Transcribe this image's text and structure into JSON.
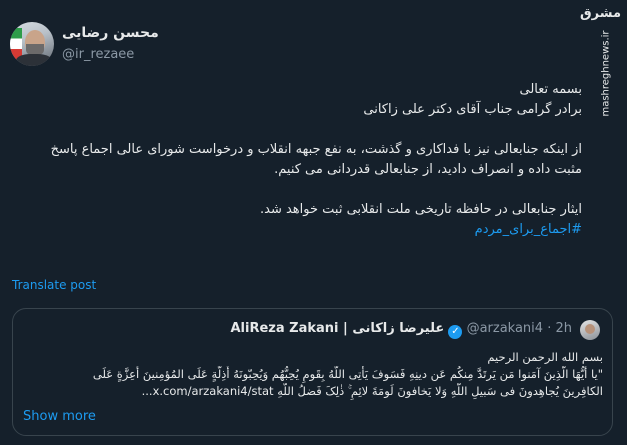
{
  "author": {
    "display_name": "محسن رضایی",
    "handle": "@ir_rezaee"
  },
  "watermark": {
    "logo_text": "مشرق",
    "site": "mashreghnews.ir"
  },
  "tweet": {
    "lines": [
      "بسمه تعالی",
      "برادر گرامی جناب آقای دکتر علی زاکانی",
      "از اینکه جنابعالی نیز با فداکاری و گذشت، به نفع جبهه انقلاب و درخواست شورای عالی اجماع پاسخ",
      "مثبت داده و انصراف دادید، از جنابعالی قدردانی می کنیم.",
      "ایثار جنابعالی در حافظه تاریخی ملت انقلابی ثبت خواهد شد."
    ],
    "hashtag": "#اجماع_برای_مردم"
  },
  "translate_label": "Translate post",
  "quote": {
    "name_en": "AliReza Zakani",
    "separator": " | ",
    "name_fa": "علیرضا زاکانی",
    "verified_glyph": "✓",
    "handle": "@arzakani4",
    "dot": "·",
    "time": "2h",
    "lines": [
      "بسم الله الرحمن الرحیم",
      "\"یا أَیُّهَا الَّذِینَ آمَنوا مَن یَرتَدَّ مِنکُم عَن دینِهِ فَسَوفَ یَأتِی اللَّهُ بِقَومٍ یُحِبُّهُم وَیُحِبّونَهُ أَذِلَّةٍ عَلَى المُؤمِنینَ أَعِزَّةٍ عَلَى",
      "الکافِرینَ یُجاهِدونَ فی سَبیلِ اللَّهِ وَلا یَخافونَ لَومَةَ لائِمٍ ۚ ذٰلِکَ فَضلُ اللَّهِ x.com/arzakani4/stat..."
    ],
    "show_more": "Show more"
  }
}
